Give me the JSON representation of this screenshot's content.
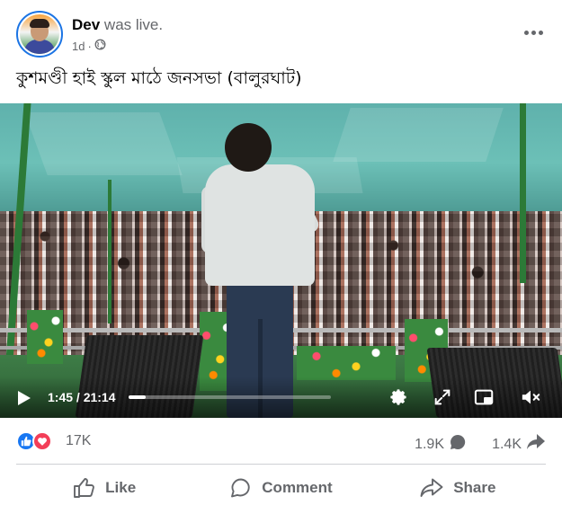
{
  "post": {
    "author_name": "Dev",
    "author_verb": "was live.",
    "age": "1d",
    "audience_icon": "globe-icon",
    "caption": "কুশমণ্ডী হাই স্কুল মাঠে জনসভা (বালুরঘাট)"
  },
  "video": {
    "current_time": "1:45",
    "duration": "21:14",
    "time_display": "1:45 / 21:14",
    "progress": 0.0824,
    "icons": [
      "play-icon",
      "settings-gear-icon",
      "fullscreen-icon",
      "picture-in-picture-icon",
      "volume-muted-icon"
    ]
  },
  "stats": {
    "reaction_count": "17K",
    "reaction_types": [
      "like",
      "love"
    ],
    "comments": "1.9K",
    "shares": "1.4K"
  },
  "actions": {
    "like": "Like",
    "comment": "Comment",
    "share": "Share"
  },
  "colors": {
    "like_blue": "#1877f2",
    "love_red": "#f33e58",
    "secondary_text": "#65676b",
    "avatar_ring": "#1b74e4"
  }
}
